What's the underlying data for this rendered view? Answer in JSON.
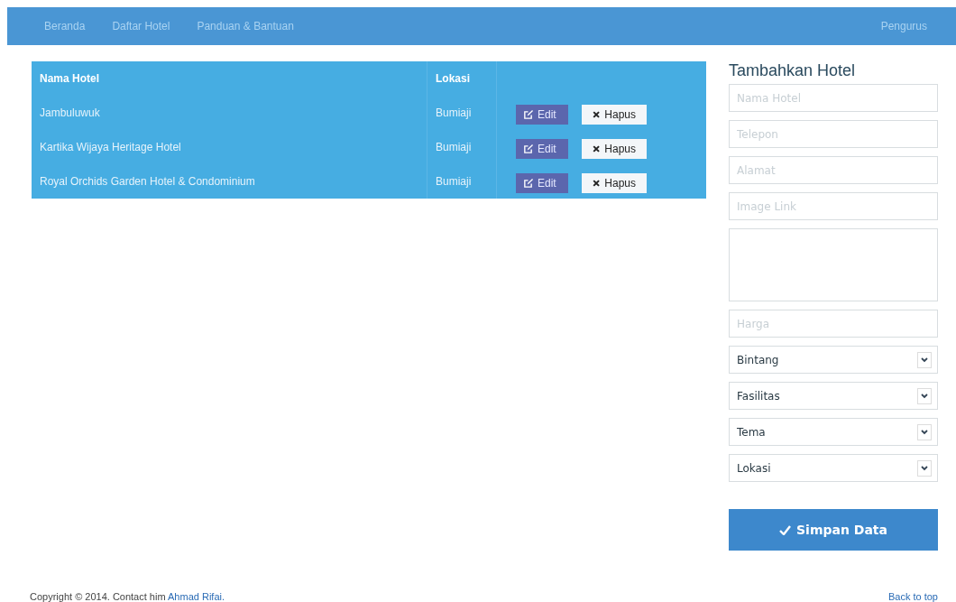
{
  "navbar": {
    "links": [
      {
        "label": "Beranda"
      },
      {
        "label": "Daftar Hotel"
      },
      {
        "label": "Panduan & Bantuan"
      }
    ],
    "right_link": "Pengurus"
  },
  "table": {
    "columns": [
      "Nama Hotel",
      "Lokasi"
    ],
    "rows": [
      {
        "name": "Jambuluwuk",
        "location": "Bumiaji",
        "actions": [
          "Edit",
          "Hapus"
        ]
      },
      {
        "name": "Kartika Wijaya Heritage Hotel",
        "location": "Bumiaji",
        "actions": [
          "Edit",
          "Hapus"
        ]
      },
      {
        "name": "Royal Orchids Garden Hotel & Condominium",
        "location": "Bumiaji",
        "actions": [
          "Edit",
          "Hapus"
        ]
      }
    ]
  },
  "form": {
    "title": "Tambahkan Hotel",
    "fields": [
      {
        "kind": "input",
        "placeholder": "Nama Hotel"
      },
      {
        "kind": "input",
        "placeholder": "Telepon"
      },
      {
        "kind": "input",
        "placeholder": "Alamat"
      },
      {
        "kind": "input",
        "placeholder": "Image Link"
      },
      {
        "kind": "textarea"
      },
      {
        "kind": "input",
        "placeholder": "Harga"
      },
      {
        "kind": "select",
        "value": "Bintang"
      },
      {
        "kind": "select",
        "value": "Fasilitas"
      },
      {
        "kind": "select",
        "value": "Tema"
      },
      {
        "kind": "select",
        "value": "Lokasi"
      }
    ],
    "submit": "Simpan Data"
  },
  "footer": {
    "text": "Copyright © 2014. Contact him",
    "link": "Ahmad Rifai.",
    "back_to_top": "Back to top"
  }
}
